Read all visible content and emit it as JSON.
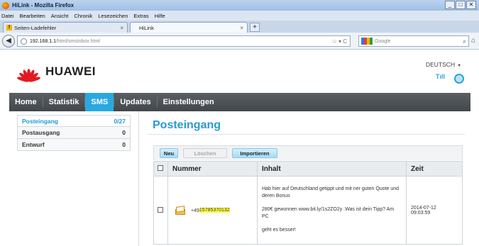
{
  "browser": {
    "window_title": "HiLink - Mozilla Firefox",
    "window_buttons": [
      "_",
      "□",
      "✕"
    ],
    "menu": [
      "Datei",
      "Bearbeiten",
      "Ansicht",
      "Chronik",
      "Lesezeichen",
      "Extras",
      "Hilfe"
    ],
    "tabs": [
      {
        "label": "Seiten-Ladefehler",
        "close": "×"
      },
      {
        "label": "HiLink",
        "close": "×"
      }
    ],
    "new_tab": "+",
    "back": "◀",
    "url_host": "192.168.1.1",
    "url_path": "/html/smsinbox.html",
    "url_controls": "☆ ▾ C",
    "search_placeholder": "Google",
    "search_icon": "⌕",
    "home_icon": "⌂"
  },
  "header": {
    "logo_text": "HUAWEI",
    "language": "DEUTSCH",
    "lang_caret": "▼",
    "signal": "Tıll"
  },
  "nav": {
    "items": [
      "Home",
      "Statistik",
      "SMS",
      "Updates",
      "Einstellungen"
    ],
    "active": "SMS"
  },
  "sidebar": {
    "items": [
      {
        "label": "Posteingang",
        "count": "0/27"
      },
      {
        "label": "Postausgang",
        "count": "0"
      },
      {
        "label": "Entwurf",
        "count": "0"
      }
    ]
  },
  "main": {
    "title": "Posteingang",
    "buttons": {
      "new": "Neu",
      "delete": "Löschen",
      "import": "Importieren"
    },
    "columns": {
      "number": "Nummer",
      "content": "Inhalt",
      "time": "Zeit"
    },
    "message": {
      "number_prefix": "+49",
      "number_highlight": "15785370132",
      "content_p1": "Hab hier auf Deutschland getippt und mit ner guten Quote und deren Bonus",
      "content_p2": "280€ gewonnen www.bit.ly/1s2ZO2y .Was ist dein Tipp? Am PC",
      "content_p3": "geht es besser!",
      "date": "2014-07-12",
      "time": "09:03:59"
    }
  },
  "colors": {
    "accent": "#29a8e0",
    "nav_bg": "#4a4e52",
    "brand_red": "#e11b22",
    "highlight": "#ffff3a"
  }
}
